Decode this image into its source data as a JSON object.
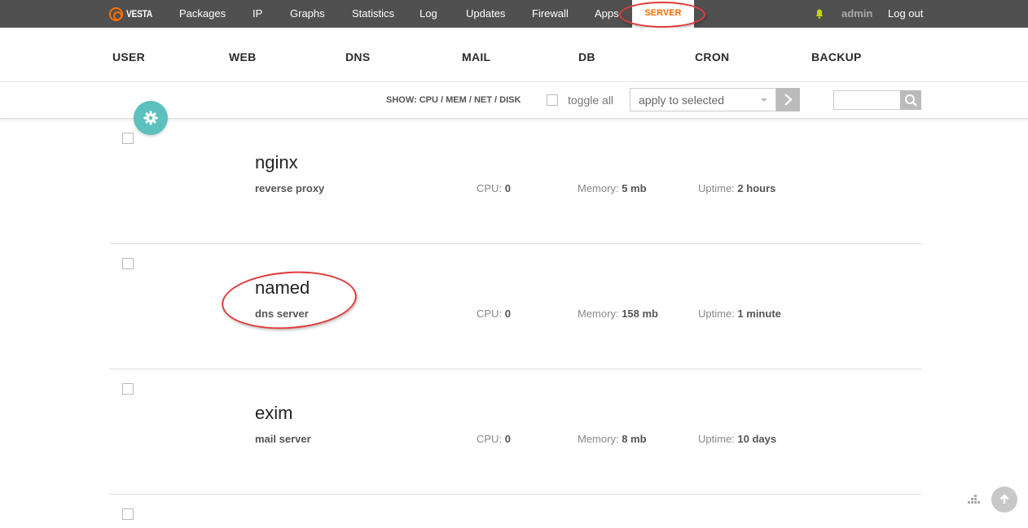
{
  "topbar": {
    "logo": "VESTA",
    "nav": [
      "Packages",
      "IP",
      "Graphs",
      "Statistics",
      "Log",
      "Updates",
      "Firewall",
      "Apps"
    ],
    "active": "SERVER",
    "user": "admin",
    "logout": "Log out"
  },
  "secnav": [
    "USER",
    "WEB",
    "DNS",
    "MAIL",
    "DB",
    "CRON",
    "BACKUP"
  ],
  "toolbar": {
    "show_label": "SHOW: CPU / MEM / NET / DISK",
    "toggle_all": "toggle all",
    "apply_placeholder": "apply to selected"
  },
  "services": [
    {
      "name": "nginx",
      "desc": "reverse proxy",
      "cpu_label": "CPU:",
      "cpu": "0",
      "mem_label": "Memory:",
      "mem": "5 mb",
      "up_label": "Uptime:",
      "up": "2 hours"
    },
    {
      "name": "named",
      "desc": "dns server",
      "cpu_label": "CPU:",
      "cpu": "0",
      "mem_label": "Memory:",
      "mem": "158 mb",
      "up_label": "Uptime:",
      "up": "1 minute"
    },
    {
      "name": "exim",
      "desc": "mail server",
      "cpu_label": "CPU:",
      "cpu": "0",
      "mem_label": "Memory:",
      "mem": "8 mb",
      "up_label": "Uptime:",
      "up": "10 days"
    }
  ],
  "colors": {
    "topbar": "#505050",
    "accent": "#ff6a00",
    "fab": "#5bc0be",
    "annotation": "#e23b3b"
  }
}
